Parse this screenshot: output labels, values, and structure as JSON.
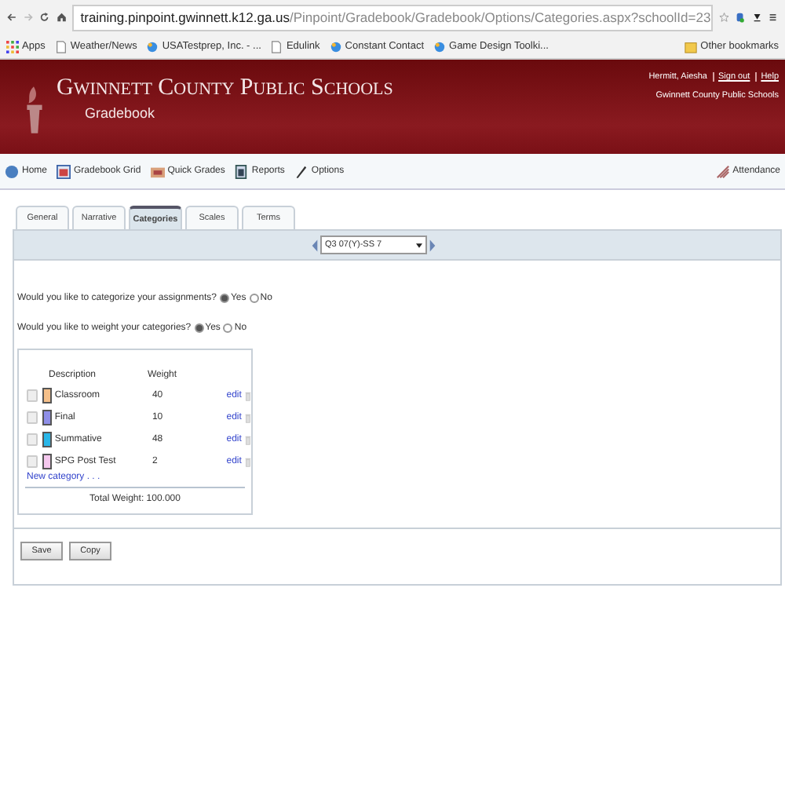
{
  "browser": {
    "url_host": "training.pinpoint.gwinnett.k12.ga.us",
    "url_path": "/Pinpoint/Gradebook/Gradebook/Options/Categories.aspx?schoolId=23",
    "bookmarks": [
      {
        "label": "Apps",
        "kind": "apps"
      },
      {
        "label": "Weather/News",
        "kind": "page"
      },
      {
        "label": "USATestprep, Inc. - ...",
        "kind": "site"
      },
      {
        "label": "Edulink",
        "kind": "page"
      },
      {
        "label": "Constant Contact",
        "kind": "site"
      },
      {
        "label": "Game Design Toolki...",
        "kind": "site"
      }
    ],
    "other_bookmarks": "Other bookmarks"
  },
  "header": {
    "title": "Gwinnett County Public Schools",
    "subtitle": "Gradebook",
    "user": "Hermitt, Aiesha",
    "sign_out": "Sign out",
    "help": "Help",
    "org": "Gwinnett County Public Schools"
  },
  "toolbar": {
    "items": [
      {
        "label": "Home"
      },
      {
        "label": "Gradebook Grid"
      },
      {
        "label": "Quick Grades"
      },
      {
        "label": "Reports"
      },
      {
        "label": "Options"
      }
    ],
    "right": "Attendance"
  },
  "tabs": [
    {
      "label": "General",
      "selected": false
    },
    {
      "label": "Narrative",
      "selected": false
    },
    {
      "label": "Categories",
      "selected": true
    },
    {
      "label": "Scales",
      "selected": false
    },
    {
      "label": "Terms",
      "selected": false
    }
  ],
  "term_select": {
    "value": "Q3 07(Y)-SS 7"
  },
  "questions": [
    {
      "text": "Would you like to categorize your assignments?",
      "options": [
        {
          "label": "Yes",
          "selected": true
        },
        {
          "label": "No",
          "selected": false
        }
      ]
    },
    {
      "text": "Would you like to weight your categories?",
      "options": [
        {
          "label": "Yes",
          "selected": true
        },
        {
          "label": "No",
          "selected": false
        }
      ]
    }
  ],
  "categories": {
    "columns": [
      "Description",
      "Weight"
    ],
    "rows": [
      {
        "description": "Classroom",
        "weight": "40",
        "color": "#f5c08a",
        "edit": "edit",
        "checked": false
      },
      {
        "description": "Final",
        "weight": "10",
        "color": "#8f8fe8",
        "edit": "edit",
        "checked": false
      },
      {
        "description": "Summative",
        "weight": "48",
        "color": "#29b6e8",
        "edit": "edit",
        "checked": false
      },
      {
        "description": "SPG Post Test",
        "weight": "2",
        "color": "#f5c8ee",
        "edit": "edit",
        "checked": false
      }
    ],
    "new_link": "New category . . .",
    "total": "Total Weight: 100.000"
  },
  "buttons": [
    "Save",
    "Copy"
  ]
}
